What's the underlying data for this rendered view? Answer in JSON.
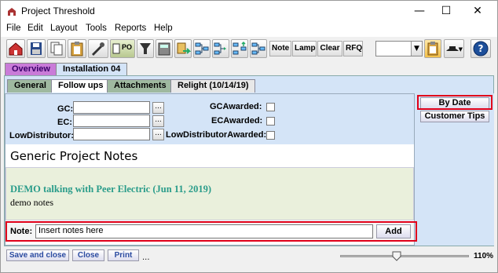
{
  "window": {
    "title": "Project Threshold",
    "min": "—",
    "max": "☐",
    "close": "✕"
  },
  "menu": [
    "File",
    "Edit",
    "Layout",
    "Tools",
    "Reports",
    "Help"
  ],
  "toolbar": {
    "text_buttons": [
      "Note",
      "Lamp",
      "Clear",
      "RFQ"
    ],
    "po_label": "PO"
  },
  "top_tabs": [
    "Overview",
    "Installation 04"
  ],
  "sub_tabs": [
    "General",
    "Follow ups",
    "Attachments",
    "Relight (10/14/19)"
  ],
  "form": {
    "gc_label": "GC:",
    "ec_label": "EC:",
    "low_label": "LowDistributor:",
    "gc_awarded": "GCAwarded:",
    "ec_awarded": "ECAwarded:",
    "low_awarded": "LowDistributorAwarded:",
    "dots": "..."
  },
  "side": {
    "by_date": "By Date",
    "customer_tips": "Customer Tips"
  },
  "notes": {
    "header": "Generic Project Notes",
    "entry_title": "DEMO talking with Peer Electric (Jun 11, 2019)",
    "entry_text": "demo notes",
    "note_label": "Note:",
    "note_value": "Insert notes here",
    "add_label": "Add"
  },
  "bottom": {
    "save_close": "Save and close",
    "close": "Close",
    "print": "Print",
    "ellipsis": "...",
    "zoom": "110%",
    "zoom_fraction": 0.43
  },
  "colors": {
    "accent_red": "#e0001a",
    "panel_blue": "#d4e4f7",
    "note_teal": "#2a9c8a"
  }
}
